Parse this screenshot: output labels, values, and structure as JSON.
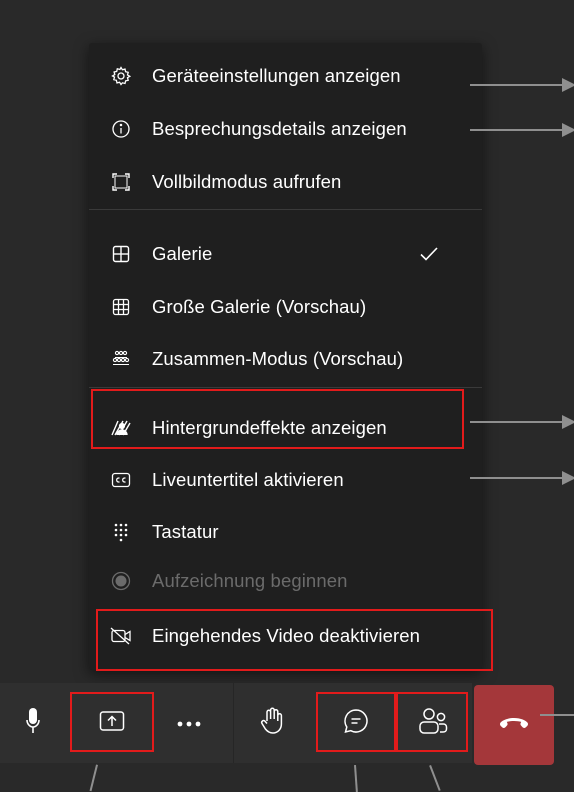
{
  "menu": {
    "items": [
      {
        "label": "Geräteeinstellungen anzeigen",
        "icon": "gear-icon"
      },
      {
        "label": "Besprechungsdetails anzeigen",
        "icon": "info-icon"
      },
      {
        "label": "Vollbildmodus aufrufen",
        "icon": "fullscreen-icon"
      },
      {
        "label": "Galerie",
        "icon": "gallery-icon",
        "checked": true
      },
      {
        "label": "Große Galerie (Vorschau)",
        "icon": "large-gallery-icon"
      },
      {
        "label": "Zusammen-Modus (Vorschau)",
        "icon": "together-mode-icon"
      },
      {
        "label": "Hintergrundeffekte anzeigen",
        "icon": "background-effects-icon"
      },
      {
        "label": "Liveuntertitel aktivieren",
        "icon": "closed-captions-icon"
      },
      {
        "label": "Tastatur",
        "icon": "dialpad-icon"
      },
      {
        "label": "Aufzeichnung beginnen",
        "icon": "record-icon",
        "disabled": true
      },
      {
        "label": "Eingehendes Video deaktivieren",
        "icon": "video-off-icon"
      }
    ]
  },
  "toolbar": {
    "buttons": [
      {
        "name": "microphone-icon"
      },
      {
        "name": "share-screen-icon"
      },
      {
        "name": "more-options-icon"
      },
      {
        "name": "raise-hand-icon"
      },
      {
        "name": "chat-icon"
      },
      {
        "name": "participants-icon"
      },
      {
        "name": "hang-up-icon"
      }
    ]
  },
  "colors": {
    "menu_bg": "#1f1f1f",
    "toolbar_bg": "#2f2f2f",
    "hangup": "#a4373a",
    "highlight": "#e21b1b",
    "annotation": "#8f8f8f"
  }
}
